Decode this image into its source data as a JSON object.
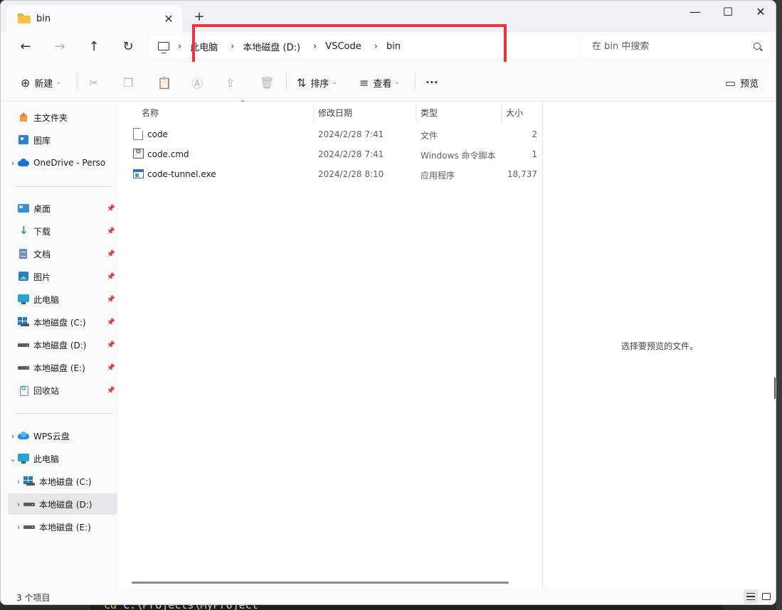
{
  "window": {
    "tab_title": "bin",
    "close_tab_glyph": "✕",
    "new_tab_glyph": "+",
    "minimize_glyph": "—",
    "maximize_glyph": "☐",
    "close_glyph": "✕"
  },
  "nav": {
    "back_glyph": "←",
    "forward_glyph": "→",
    "up_glyph": "↑",
    "refresh_glyph": "↻",
    "breadcrumb": [
      "此电脑",
      "本地磁盘 (D:)",
      "VSCode",
      "bin"
    ],
    "separator": "›",
    "search_placeholder": "在 bin 中搜索"
  },
  "toolbar": {
    "new_label": "新建",
    "sort_label": "排序",
    "view_label": "查看",
    "more_glyph": "•••",
    "preview_label": "预览",
    "icons": [
      "plus-circle-icon",
      "cut-icon",
      "copy-icon",
      "paste-icon",
      "rename-icon",
      "share-icon",
      "delete-icon",
      "sort-icon",
      "view-icon",
      "more-icon",
      "preview-pane-icon"
    ]
  },
  "sidebar": {
    "quick": [
      {
        "label": "主文件夹",
        "icon": "home-icon"
      },
      {
        "label": "图库",
        "icon": "gallery-icon"
      },
      {
        "label": "OneDrive - Perso",
        "icon": "onedrive-icon"
      }
    ],
    "pinned": [
      {
        "label": "桌面",
        "icon": "desktop-icon"
      },
      {
        "label": "下载",
        "icon": "download-icon"
      },
      {
        "label": "文档",
        "icon": "documents-icon"
      },
      {
        "label": "图片",
        "icon": "pictures-icon"
      },
      {
        "label": "此电脑",
        "icon": "this-pc-icon"
      },
      {
        "label": "本地磁盘 (C:)",
        "icon": "drive-c-icon"
      },
      {
        "label": "本地磁盘 (D:)",
        "icon": "drive-icon"
      },
      {
        "label": "本地磁盘 (E:)",
        "icon": "drive-icon"
      },
      {
        "label": "回收站",
        "icon": "recycle-bin-icon"
      }
    ],
    "tree": [
      {
        "label": "WPS云盘",
        "icon": "wps-cloud-icon",
        "chevron": "›"
      },
      {
        "label": "此电脑",
        "icon": "this-pc-icon",
        "chevron": "⌄"
      },
      {
        "label": "本地磁盘 (C:)",
        "icon": "drive-c-icon",
        "chevron": "›"
      },
      {
        "label": "本地磁盘 (D:)",
        "icon": "drive-icon",
        "chevron": "›",
        "selected": true
      },
      {
        "label": "本地磁盘 (E:)",
        "icon": "drive-icon",
        "chevron": "›"
      }
    ],
    "pin_glyph": "📌"
  },
  "files": {
    "columns": [
      "名称",
      "修改日期",
      "类型",
      "大小"
    ],
    "sort_glyph": "⌃",
    "rows": [
      {
        "name": "code",
        "modified": "2024/2/28 7:41",
        "type": "文件",
        "size": "2",
        "icon": "file-icon"
      },
      {
        "name": "code.cmd",
        "modified": "2024/2/28 7:41",
        "type": "Windows 命令脚本",
        "size": "1",
        "icon": "cmd-file-icon"
      },
      {
        "name": "code-tunnel.exe",
        "modified": "2024/2/28 8:10",
        "type": "应用程序",
        "size": "18,737",
        "icon": "exe-file-icon"
      }
    ]
  },
  "preview": {
    "message": "选择要预览的文件。"
  },
  "status": {
    "item_count": "3 个项目"
  },
  "background_terminal": {
    "keyword": "cd",
    "text": " C:\\Projects\\MyProject"
  }
}
